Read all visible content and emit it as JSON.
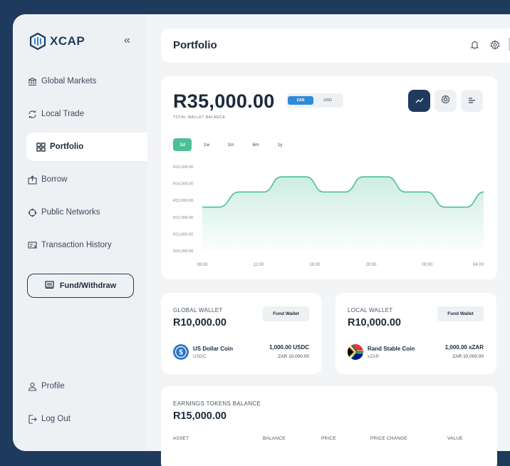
{
  "app": {
    "name": "XCAP"
  },
  "sidebar": {
    "collapse_symbol": "«",
    "items": [
      {
        "label": "Global Markets",
        "icon": "bank-icon"
      },
      {
        "label": "Local Trade",
        "icon": "exchange-icon"
      },
      {
        "label": "Portfolio",
        "icon": "grid-icon",
        "active": true
      },
      {
        "label": "Borrow",
        "icon": "borrow-icon"
      },
      {
        "label": "Public Networks",
        "icon": "network-icon"
      },
      {
        "label": "Transaction History",
        "icon": "history-icon"
      }
    ],
    "fund_button": "Fund/Withdraw",
    "bottom_items": [
      {
        "label": "Profile",
        "icon": "user-icon"
      },
      {
        "label": "Log Out",
        "icon": "logout-icon"
      }
    ]
  },
  "header": {
    "title": "Portfolio"
  },
  "balance": {
    "amount": "R35,000.00",
    "label": "TOTAL WALLET BALANCE",
    "currencies": [
      "ZAR",
      "USD"
    ],
    "selected_currency": "ZAR",
    "ranges": [
      "1d",
      "1w",
      "1m",
      "6m",
      "1y"
    ],
    "selected_range": "1d"
  },
  "chart_data": {
    "type": "area",
    "x": [
      "08:00",
      "",
      "12:00",
      "",
      "16:00",
      "",
      "20:00",
      "",
      "00:00",
      "",
      "04:00"
    ],
    "x_ticks": [
      "08:00",
      "12:00",
      "16:00",
      "20:00",
      "00:00",
      "04:00"
    ],
    "y_ticks": [
      "R15,000.00",
      "R14,000.00",
      "R13,000.00",
      "R12,000.00",
      "R11,000.00",
      "R10,000.00"
    ],
    "ylim": [
      10000,
      15000
    ],
    "points": [
      {
        "x": 0,
        "y": 12600
      },
      {
        "x": 0.06,
        "y": 12600
      },
      {
        "x": 0.13,
        "y": 13500
      },
      {
        "x": 0.22,
        "y": 13500
      },
      {
        "x": 0.28,
        "y": 14400
      },
      {
        "x": 0.37,
        "y": 14400
      },
      {
        "x": 0.43,
        "y": 13500
      },
      {
        "x": 0.51,
        "y": 13500
      },
      {
        "x": 0.57,
        "y": 14400
      },
      {
        "x": 0.66,
        "y": 14400
      },
      {
        "x": 0.72,
        "y": 13500
      },
      {
        "x": 0.8,
        "y": 13500
      },
      {
        "x": 0.86,
        "y": 12600
      },
      {
        "x": 0.94,
        "y": 12600
      },
      {
        "x": 1.0,
        "y": 13500
      }
    ],
    "line_color": "#4cbf94",
    "fill_color": "#4cbf94"
  },
  "global_wallet": {
    "title": "GLOBAL WALLET",
    "amount": "R10,000.00",
    "button": "Fund Wallet",
    "coin": {
      "name": "US Dollar Coin",
      "symbol": "USDC",
      "amount": "1,000.00 USDC",
      "fiat": "ZAR 10,000.00",
      "icon": "usdc-icon"
    }
  },
  "local_wallet": {
    "title": "LOCAL WALLET",
    "amount": "R10,000.00",
    "button": "Fund Wallet",
    "coin": {
      "name": "Rand Stable Coin",
      "symbol": "xZAR",
      "amount": "1,000.00 xZAR",
      "fiat": "ZAR 10,000.00",
      "icon": "south-africa-flag-icon"
    }
  },
  "earnings": {
    "title": "EARNINGS TOKENS BALANCE",
    "amount": "R15,000.00",
    "columns": [
      "ASSET",
      "BALANCE",
      "PRICE",
      "PRICE CHANGE",
      "VALUE"
    ]
  },
  "colors": {
    "navy": "#1e3a5c",
    "accent_green": "#4cbf94",
    "accent_blue": "#2e8bd6"
  }
}
